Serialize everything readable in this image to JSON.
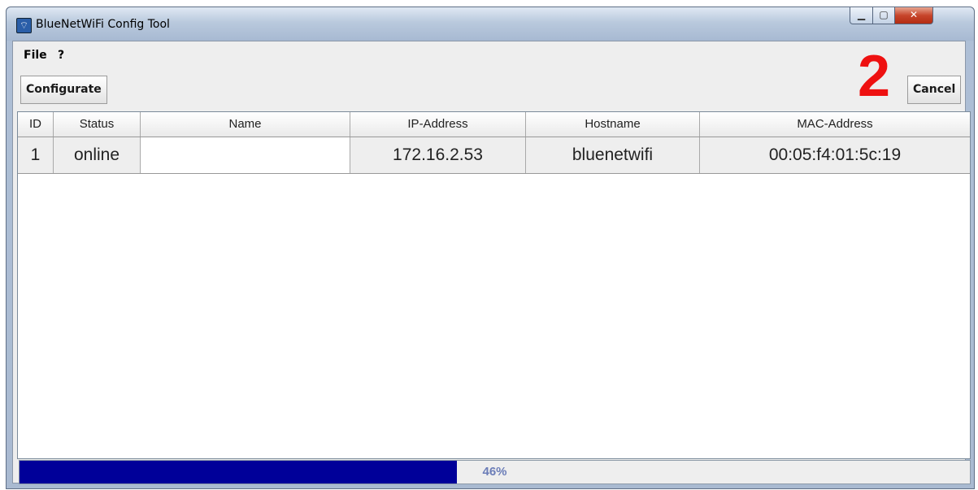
{
  "window": {
    "title": "BlueNetWiFi Config Tool",
    "icon": "wifi-app-icon"
  },
  "menu": [
    "File",
    "?"
  ],
  "toolbar": {
    "configurate_label": "Configurate",
    "cancel_label": "Cancel"
  },
  "annotation": "2",
  "table": {
    "columns": [
      "ID",
      "Status",
      "Name",
      "IP-Address",
      "Hostname",
      "MAC-Address"
    ],
    "rows": [
      [
        "1",
        "online",
        "",
        "172.16.2.53",
        "bluenetwifi",
        "00:05:f4:01:5c:19"
      ]
    ]
  },
  "progress": {
    "percent": 46,
    "label": "46%",
    "fill_color": "#000099"
  },
  "colors": {
    "annotation": "#ee1111",
    "close_button": "#c7452b"
  }
}
